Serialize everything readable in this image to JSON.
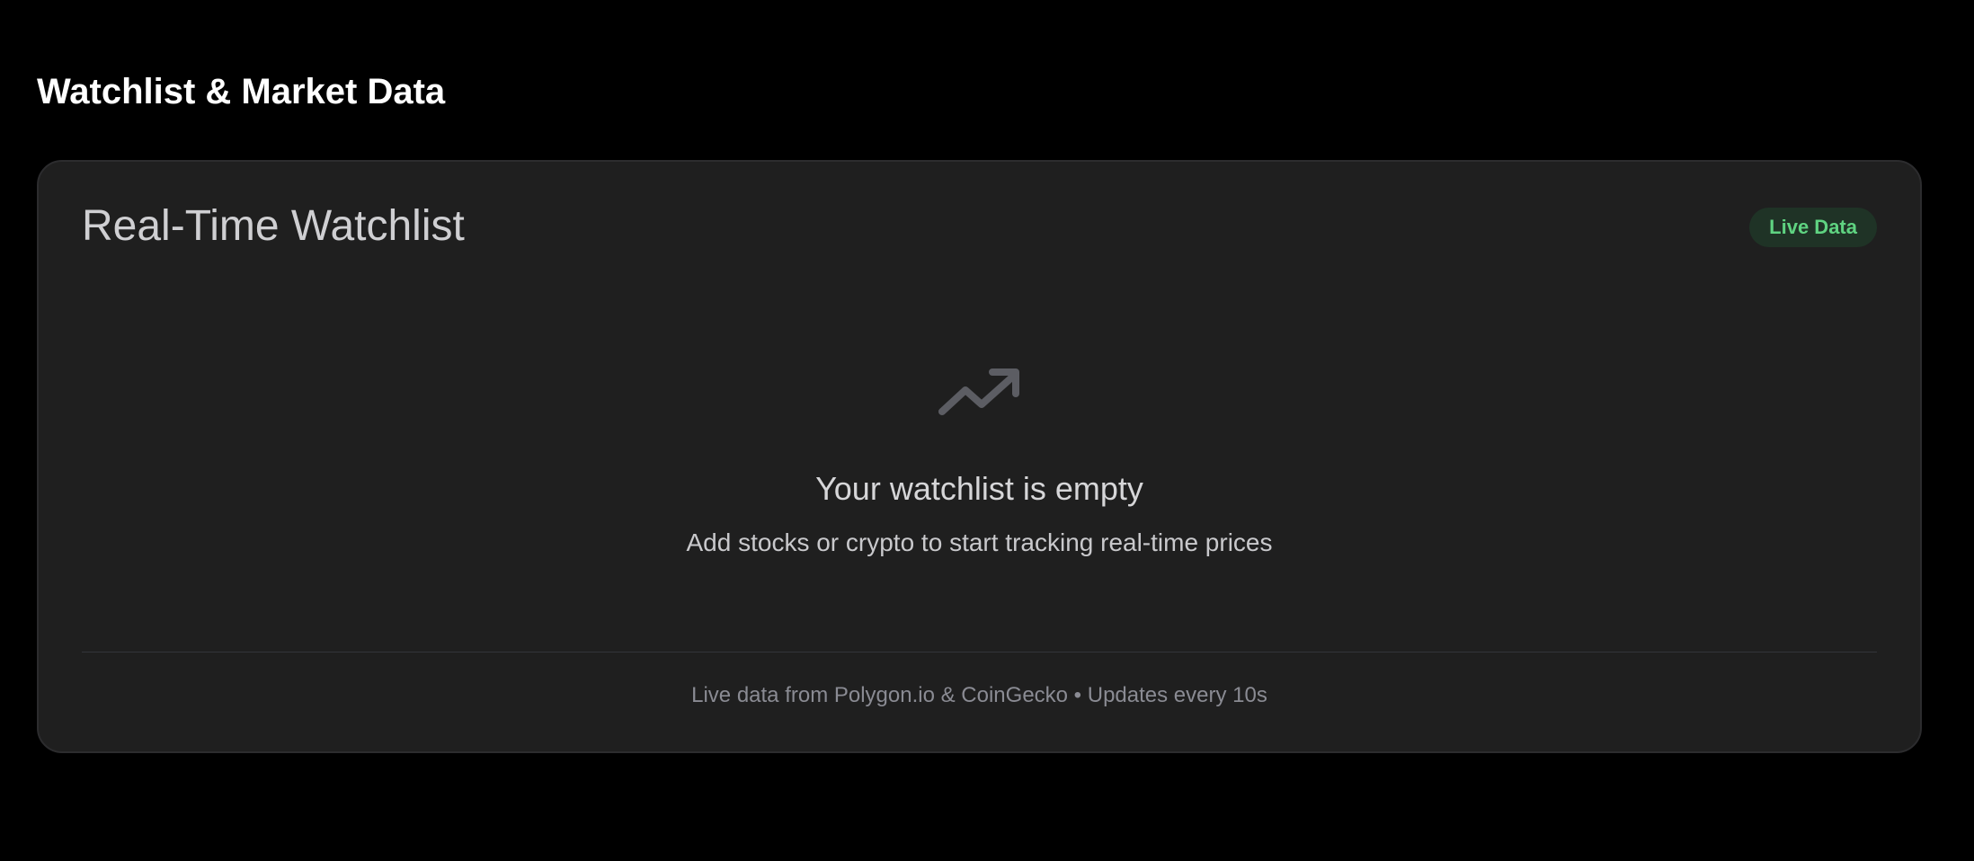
{
  "page": {
    "title": "Watchlist & Market Data"
  },
  "watchlist": {
    "title": "Real-Time Watchlist",
    "badge": "Live Data",
    "empty_icon": "trending-up-icon",
    "empty_title": "Your watchlist is empty",
    "empty_subtitle": "Add stocks or crypto to start tracking real-time prices",
    "footer": "Live data from Polygon.io & CoinGecko • Updates every 10s"
  },
  "colors": {
    "background": "#000000",
    "card": "#1f1f1f",
    "badge_bg": "#1f3326",
    "badge_text": "#5fd381",
    "icon": "#5c5d63"
  }
}
